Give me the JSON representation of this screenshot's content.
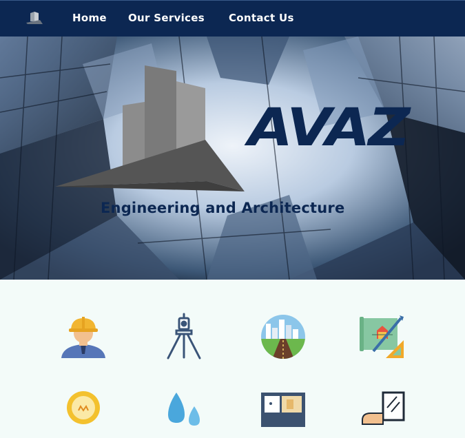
{
  "nav": {
    "logo_icon": "building-logo-icon",
    "links": [
      {
        "label": "Home"
      },
      {
        "label": "Our Services"
      },
      {
        "label": "Contact Us"
      }
    ]
  },
  "hero": {
    "brand": "AVAZ",
    "tagline": "Engineering and Architecture",
    "background": "glass-skyscrapers-looking-up"
  },
  "services": {
    "icons": [
      "engineer-hardhat-icon",
      "surveying-tripod-icon",
      "city-road-icon",
      "blueprint-plan-icon",
      "lightbulb-icon",
      "water-drops-icon",
      "floor-plan-icon",
      "window-installer-icon"
    ]
  },
  "colors": {
    "nav_bg": "#0c2752",
    "brand_navy": "#0c2752",
    "page_bg": "#f3fbf9"
  }
}
